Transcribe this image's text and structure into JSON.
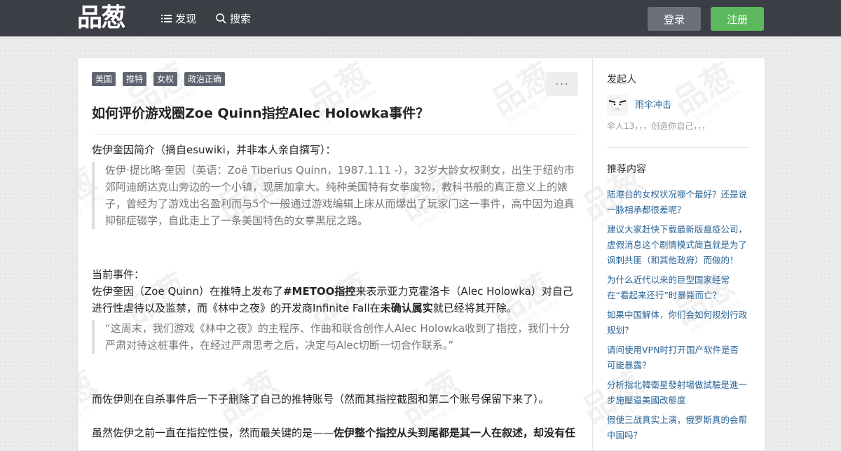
{
  "nav": {
    "logo": "品葱",
    "discover": "发现",
    "search": "搜索",
    "login": "登录",
    "register": "注册"
  },
  "question": {
    "tags": [
      "美国",
      "推特",
      "女权",
      "政治正确"
    ],
    "more": "···",
    "title": "如何评价游戏圈Zoe Quinn指控Alec Holowka事件？"
  },
  "content": {
    "intro": "佐伊奎因简介（摘自esuwiki，并非本人亲自撰写）：",
    "quote1": "佐伊·提比略·奎因（英语：Zoë Tiberius Quinn，1987.1.11 -），32岁大龄女权剩女，出生于纽约市郊阿迪朗达克山旁边的一个小镇，现居加拿大。纯种美国特有女拳废物，教科书般的真正意义上的婊子，曾经为了游戏出名盈利而与5个一般通过游戏编辑上床从而爆出了玩家门这一事件，高中因为迫真抑郁症辍学，自此走上了一条美国特色的女拳黑屁之路。",
    "current_label": "当前事件：",
    "current_1": "佐伊奎因（Zoe Quinn）在推特上发布了",
    "current_bold1": "#METOO指控",
    "current_2": "来表示亚力克霍洛卡（Alec Holowka）对自己进行性虐待以及监禁，而《林中之夜》的开发商Infinite Fall在",
    "current_bold2": "未确认属实",
    "current_3": "就已经将其开除。",
    "quote2": "“这周末，我们游戏《林中之夜》的主程序、作曲和联合创作人Alec Holowka收到了指控，我们十分严肃对待这桩事件，在经过严肃思考之后，决定与Alec切断一切合作联系。”",
    "para3": "而佐伊则在自杀事件后一下子删除了自己的推特账号（然而其指控截图和第二个账号保留下来了）。",
    "para4_1": "虽然佐伊之前一直在指控性侵，然而最关键的是——",
    "para4_bold": "佐伊整个指控从头到尾都是其一人在叙述，却没有任"
  },
  "sidebar": {
    "initiator_label": "发起人",
    "author": "雨伞冲击",
    "bio": "伞人13，，，创造你自己，，，",
    "recommended_label": "推荐内容",
    "items": [
      "陆港台的女权状况哪个最好？还是说一脉相承都很差呢？",
      "建议大家赶快下载最新版瘟疫公司，虚假消息这个剧情模式简直就是为了讽刺共匪（和其他政府）而做的！",
      "为什么近代以来的巨型国家经常在“看起来还行”时暴毙而亡？",
      "如果中国解体，你们会如何规划行政规划？",
      "请问使用VPN时打开国产软件是否可能暴露？",
      "分析指北韓衛星發射場做試驗是進一步施壓逼美國改態度",
      "假使三战真实上演，俄罗斯真的会帮中国吗？"
    ]
  },
  "watermark": {
    "text": "品葱",
    "sub": "pincong.rocks"
  },
  "colors": {
    "navbar": "#3b3e45",
    "login": "#6b6f7a",
    "register": "#5cb85c",
    "tag": "#5f6470",
    "link": "#2a6496"
  }
}
